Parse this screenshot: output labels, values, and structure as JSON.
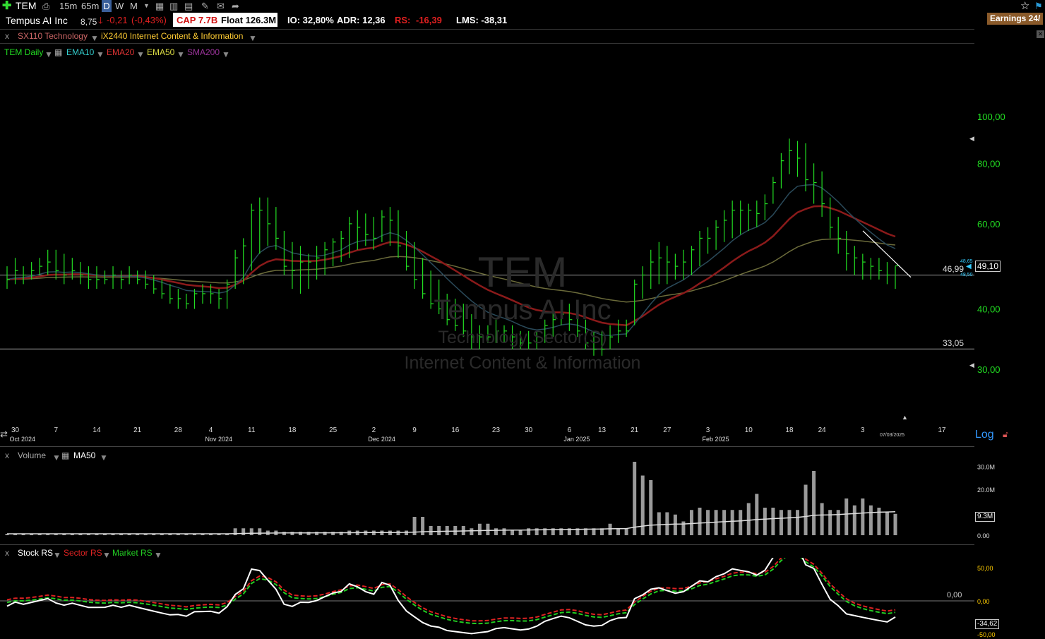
{
  "toolbar": {
    "symbol": "TEM",
    "timeframes": [
      "15m",
      "65m",
      "D",
      "W",
      "M"
    ],
    "active_timeframe": "D",
    "earnings_badge": "Earnings 24/"
  },
  "info": {
    "company": "Tempus AI Inc",
    "price": "8,75",
    "change": "-0,21",
    "change_pct": "(-0,43%)",
    "cap": "CAP 7.7B",
    "float": "Float 126.3M",
    "io": "IO: 32,80%",
    "adr": "ADR: 12,36",
    "rs_label": "RS:",
    "rs_value": "-16,39",
    "lms": "LMS: -38,31"
  },
  "sector": {
    "close": "x",
    "sector": "SX110 Technology",
    "industry": "iX2440 Internet Content & Information"
  },
  "price_legend": {
    "symbol": "TEM Daily",
    "ema10": "EMA10",
    "ema20": "EMA20",
    "ema50": "EMA50",
    "sma200": "SMA200"
  },
  "watermark": {
    "ticker": "TEM",
    "name": "Tempus AI Inc",
    "sector": "Technology Sector(S)",
    "industry": "Internet Content & Information"
  },
  "price_axis": {
    "ticks": [
      "100,00",
      "80,00",
      "60,00",
      "40,00",
      "30,00"
    ],
    "tick_values": [
      100,
      80,
      60,
      40,
      30
    ],
    "last_price": "49,10",
    "last_price_value": 49.1,
    "bid": "48,65",
    "ask": "48,50",
    "hlines": [
      {
        "label": "46,99",
        "value": 46.99
      },
      {
        "label": "33,05",
        "value": 33.05
      }
    ],
    "log_label": "Log"
  },
  "date_axis": {
    "days": [
      "30",
      "7",
      "14",
      "21",
      "28",
      "4",
      "11",
      "18",
      "25",
      "2",
      "9",
      "16",
      "23",
      "30",
      "6",
      "13",
      "21",
      "27",
      "3",
      "10",
      "18",
      "24",
      "3",
      "17"
    ],
    "months": [
      "Oct 2024",
      "Nov 2024",
      "Dec 2024",
      "Jan 2025",
      "Feb 2025"
    ],
    "cursor_date": "07/03/2025"
  },
  "volume_pane": {
    "close": "x",
    "label": "Volume",
    "ma_label": "MA50",
    "ticks": [
      "30.0M",
      "20.0M",
      "0.00"
    ],
    "tick_values": [
      30,
      20,
      0
    ],
    "current": "9.3M"
  },
  "rs_pane": {
    "close": "x",
    "stock_label": "Stock RS",
    "sector_label": "Sector RS",
    "market_label": "Market RS",
    "ticks": [
      "50,00",
      "0,00",
      "-50,00"
    ],
    "tick_values": [
      50,
      0,
      -50
    ],
    "zero_label": "0,00",
    "current": "-34,62"
  },
  "colors": {
    "up_bar": "#22dd22",
    "ema10": "#2a4a5a",
    "ema20": "#8b1a1a",
    "ema50": "#6b6b3a",
    "stock_rs": "#ffffff",
    "sector_rs": "#dd2222",
    "market_rs": "#22cc22",
    "volume": "#9a9a9a"
  },
  "chart_data": {
    "type": "bar",
    "series_note_symbol": "TEM",
    "x": [
      "2024-09-27",
      "2024-09-30",
      "2024-10-01",
      "2024-10-02",
      "2024-10-03",
      "2024-10-04",
      "2024-10-07",
      "2024-10-08",
      "2024-10-09",
      "2024-10-10",
      "2024-10-11",
      "2024-10-14",
      "2024-10-15",
      "2024-10-16",
      "2024-10-17",
      "2024-10-18",
      "2024-10-21",
      "2024-10-22",
      "2024-10-23",
      "2024-10-24",
      "2024-10-25",
      "2024-10-28",
      "2024-10-29",
      "2024-10-30",
      "2024-10-31",
      "2024-11-01",
      "2024-11-04",
      "2024-11-05",
      "2024-11-06",
      "2024-11-07",
      "2024-11-08",
      "2024-11-11",
      "2024-11-12",
      "2024-11-13",
      "2024-11-14",
      "2024-11-15",
      "2024-11-18",
      "2024-11-19",
      "2024-11-20",
      "2024-11-21",
      "2024-11-22",
      "2024-11-25",
      "2024-11-26",
      "2024-11-27",
      "2024-11-29",
      "2024-12-02",
      "2024-12-03",
      "2024-12-04",
      "2024-12-05",
      "2024-12-06",
      "2024-12-09",
      "2024-12-10",
      "2024-12-11",
      "2024-12-12",
      "2024-12-13",
      "2024-12-16",
      "2024-12-17",
      "2024-12-18",
      "2024-12-19",
      "2024-12-20",
      "2024-12-23",
      "2024-12-24",
      "2024-12-26",
      "2024-12-27",
      "2024-12-30",
      "2024-12-31",
      "2025-01-02",
      "2025-01-03",
      "2025-01-06",
      "2025-01-07",
      "2025-01-08",
      "2025-01-10",
      "2025-01-13",
      "2025-01-14",
      "2025-01-15",
      "2025-01-16",
      "2025-01-17",
      "2025-01-21",
      "2025-01-22",
      "2025-01-23",
      "2025-01-24",
      "2025-01-27",
      "2025-01-28",
      "2025-01-29",
      "2025-01-30",
      "2025-01-31",
      "2025-02-03",
      "2025-02-04",
      "2025-02-05",
      "2025-02-06",
      "2025-02-07",
      "2025-02-10",
      "2025-02-11",
      "2025-02-12",
      "2025-02-13",
      "2025-02-14",
      "2025-02-18",
      "2025-02-19",
      "2025-02-20",
      "2025-02-21",
      "2025-02-24",
      "2025-02-25",
      "2025-02-26",
      "2025-02-27",
      "2025-02-28",
      "2025-03-03",
      "2025-03-04",
      "2025-03-05",
      "2025-03-06",
      "2025-03-07"
    ],
    "high": [
      49,
      51,
      49,
      50,
      51,
      53,
      53,
      52,
      51,
      50,
      49,
      49,
      48,
      49,
      48,
      49,
      48,
      48,
      47,
      46,
      45,
      44,
      43,
      44,
      45,
      45,
      44,
      46,
      53,
      56,
      66,
      68,
      68,
      65,
      58,
      55,
      54,
      52,
      54,
      55,
      56,
      58,
      62,
      64,
      63,
      62,
      64,
      65,
      64,
      58,
      55,
      51,
      48,
      46,
      43,
      42,
      41,
      39,
      37,
      37,
      38,
      37,
      37,
      36,
      36,
      36,
      38,
      40,
      41,
      41,
      39,
      38,
      36,
      36,
      37,
      38,
      38,
      46,
      49,
      53,
      55,
      54,
      52,
      53,
      54,
      58,
      59,
      61,
      64,
      67,
      67,
      66,
      67,
      69,
      75,
      84,
      90,
      89,
      88,
      80,
      77,
      68,
      62,
      58,
      54,
      52,
      51,
      51,
      50,
      49
    ],
    "low": [
      44,
      45,
      45,
      46,
      47,
      47,
      46,
      45,
      46,
      45,
      44,
      44,
      45,
      44,
      44,
      45,
      45,
      44,
      43,
      42,
      41,
      40,
      40,
      40,
      41,
      41,
      40,
      40,
      44,
      45,
      48,
      52,
      54,
      53,
      47,
      44,
      43,
      44,
      46,
      47,
      49,
      50,
      51,
      53,
      54,
      53,
      55,
      54,
      51,
      48,
      44,
      42,
      40,
      39,
      37,
      36,
      35,
      33,
      33,
      34,
      34,
      34,
      33,
      33,
      33,
      33,
      34,
      35,
      37,
      36,
      35,
      33,
      32,
      32,
      33,
      34,
      35,
      37,
      42,
      44,
      45,
      45,
      46,
      46,
      47,
      49,
      52,
      53,
      55,
      56,
      57,
      58,
      59,
      61,
      66,
      71,
      76,
      75,
      70,
      66,
      62,
      56,
      52,
      48,
      47,
      46,
      46,
      46,
      45,
      44
    ],
    "close": [
      46,
      48,
      47,
      48,
      49,
      50,
      48,
      47,
      48,
      47,
      46,
      46,
      46,
      47,
      46,
      47,
      46,
      45,
      44,
      43,
      42,
      42,
      41,
      43,
      43,
      43,
      42,
      45,
      51,
      54,
      64,
      64,
      60,
      56,
      49,
      48,
      50,
      50,
      51,
      53,
      55,
      56,
      60,
      59,
      57,
      56,
      62,
      61,
      54,
      49,
      46,
      43,
      41,
      40,
      38,
      37,
      36,
      35,
      35,
      35,
      36,
      36,
      35,
      34,
      34,
      35,
      37,
      38,
      39,
      38,
      36,
      34,
      33,
      33,
      35,
      36,
      36,
      45,
      47,
      50,
      51,
      50,
      49,
      50,
      53,
      56,
      56,
      59,
      61,
      64,
      64,
      64,
      63,
      66,
      73,
      81,
      85,
      82,
      74,
      73,
      66,
      59,
      56,
      52,
      51,
      50,
      49,
      48,
      47,
      49.1
    ],
    "volume_millions": [
      0.6,
      0.6,
      0.6,
      0.6,
      0.6,
      0.6,
      0.6,
      0.6,
      0.6,
      0.6,
      0.6,
      0.6,
      0.6,
      0.6,
      0.6,
      0.6,
      0.6,
      0.6,
      0.6,
      0.6,
      0.6,
      0.6,
      0.6,
      0.6,
      0.6,
      0.6,
      0.6,
      0.6,
      3,
      3,
      3,
      3,
      2,
      2,
      1.5,
      1.5,
      1.5,
      1.5,
      1.5,
      1.5,
      1.5,
      1.5,
      2,
      2,
      2,
      2,
      2,
      2,
      2,
      2,
      8,
      8,
      4,
      4,
      4,
      4,
      4,
      3,
      5,
      5,
      3,
      3,
      2,
      2,
      3,
      3,
      3,
      3,
      3,
      3,
      3,
      3,
      3,
      3,
      5,
      3,
      3,
      32,
      26,
      24,
      10,
      10,
      9,
      6,
      11,
      12,
      11,
      11,
      11,
      11,
      11,
      14,
      18,
      12,
      12,
      11,
      11,
      11,
      22,
      28,
      14,
      11,
      11,
      16,
      13,
      16,
      13,
      12,
      10,
      9.3
    ],
    "volume_ylim": [
      0,
      32
    ],
    "ylim_log": [
      25,
      105
    ]
  }
}
